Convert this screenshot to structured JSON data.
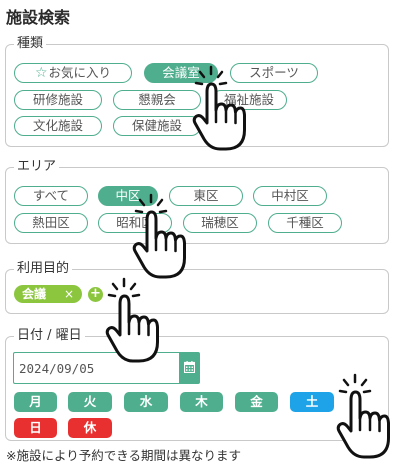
{
  "title": "施設検索",
  "facility_type": {
    "legend": "種類",
    "items": [
      {
        "label": "お気に入り",
        "icon": "star-icon",
        "active": false
      },
      {
        "label": "会議室",
        "active": true
      },
      {
        "label": "スポーツ",
        "active": false
      },
      {
        "label": "研修施設",
        "active": false
      },
      {
        "label": "懇親会",
        "active": false
      },
      {
        "label": "福祉施設",
        "active": false
      },
      {
        "label": "文化施設",
        "active": false
      },
      {
        "label": "保健施設",
        "active": false
      }
    ]
  },
  "area": {
    "legend": "エリア",
    "items": [
      {
        "label": "すべて",
        "active": false
      },
      {
        "label": "中区",
        "active": true
      },
      {
        "label": "東区",
        "active": false
      },
      {
        "label": "中村区",
        "active": false
      },
      {
        "label": "熱田区",
        "active": false
      },
      {
        "label": "昭和区",
        "active": false
      },
      {
        "label": "瑞穂区",
        "active": false
      },
      {
        "label": "千種区",
        "active": false
      }
    ]
  },
  "purpose": {
    "legend": "利用目的",
    "chip_label": "会議",
    "chip_remove": "×",
    "add_label": "+"
  },
  "date": {
    "legend": "日付 / 曜日",
    "value": "2024/09/05",
    "calendar_icon": "calendar-icon",
    "weekdays": [
      "月",
      "火",
      "水",
      "木",
      "金",
      "土"
    ],
    "weekend_extra": [
      "日",
      "休"
    ],
    "selected": "土"
  },
  "note": "※施設により予約できる期間は異なります",
  "colors": {
    "accent": "#4fae8e",
    "chip": "#8cc63f",
    "saturday": "#1fa3e8",
    "holiday": "#e83030"
  }
}
